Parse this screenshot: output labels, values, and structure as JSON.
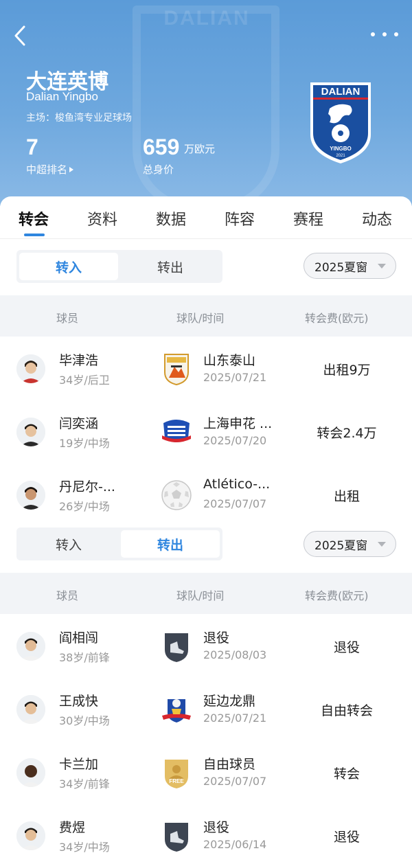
{
  "header": {
    "club_name": "大连英博",
    "club_name_en": "Dalian Yingbo",
    "stadium": "主场：梭鱼湾专业足球场",
    "rank_value": "7",
    "rank_label": "中超排名",
    "value_number": "659",
    "value_unit": "万欧元",
    "value_label": "总身价",
    "logo_top_text": "DALIAN",
    "logo_bottom_text": "YINGBO",
    "logo_year": "2021",
    "watermark_text": "DALIAN"
  },
  "tabs": [
    "转会",
    "资料",
    "数据",
    "阵容",
    "赛程",
    "动态"
  ],
  "active_tab": "转会",
  "colors": {
    "accent": "#2f86df",
    "header": "#6ea8de"
  },
  "transfers_in": {
    "toggle": {
      "in_label": "转入",
      "out_label": "转出",
      "selected": "in"
    },
    "season": "2025夏窗",
    "columns": {
      "player": "球员",
      "team_time": "球队/时间",
      "fee": "转会费(欧元)"
    },
    "rows": [
      {
        "name": "毕津浩",
        "meta": "34岁/后卫",
        "team": "山东泰山",
        "date": "2025/07/21",
        "fee": "出租9万",
        "team_icon": "shandong-taishan-logo"
      },
      {
        "name": "闫奕涵",
        "meta": "19岁/中场",
        "team": "上海申花 ...",
        "date": "2025/07/20",
        "fee": "转会2.4万",
        "team_icon": "shanghai-shenhua-logo"
      },
      {
        "name": "丹尼尔-...",
        "meta": "26岁/中场",
        "team": "Atlético-...",
        "date": "2025/07/07",
        "fee": "出租",
        "team_icon": "soccer-ball-icon"
      }
    ]
  },
  "transfers_out": {
    "toggle": {
      "in_label": "转入",
      "out_label": "转出",
      "selected": "out"
    },
    "season": "2025夏窗",
    "columns": {
      "player": "球员",
      "team_time": "球队/时间",
      "fee": "转会费(欧元)"
    },
    "rows": [
      {
        "name": "阎相闯",
        "meta": "38岁/前锋",
        "team": "退役",
        "date": "2025/08/03",
        "fee": "退役",
        "team_icon": "retired-boot-icon"
      },
      {
        "name": "王成快",
        "meta": "30岁/中场",
        "team": "延边龙鼎",
        "date": "2025/07/21",
        "fee": "自由转会",
        "team_icon": "yanbian-longding-logo"
      },
      {
        "name": "卡兰加",
        "meta": "34岁/前锋",
        "team": "自由球员",
        "date": "2025/07/07",
        "fee": "转会",
        "team_icon": "free-agent-badge-icon"
      },
      {
        "name": "费煜",
        "meta": "34岁/中场",
        "team": "退役",
        "date": "2025/06/14",
        "fee": "退役",
        "team_icon": "retired-boot-icon"
      }
    ],
    "free_badge_text": "FREE"
  }
}
